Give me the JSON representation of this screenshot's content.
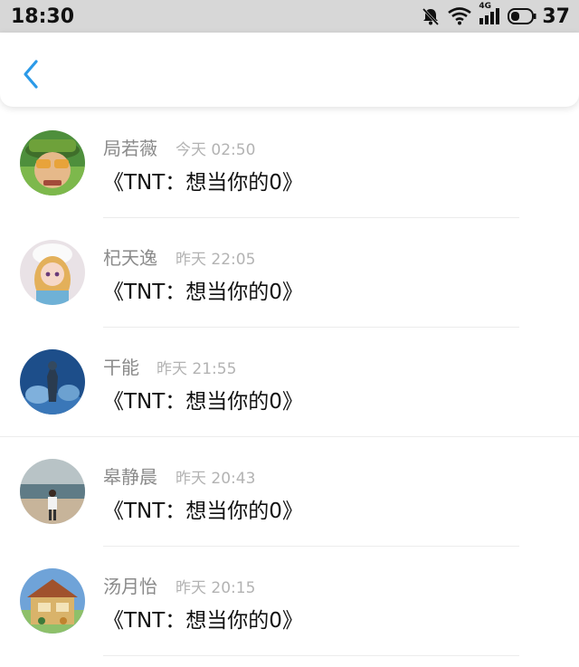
{
  "status_bar": {
    "time": "18:30",
    "network_label": "4G",
    "battery": "37",
    "icons": [
      "muted-bell-icon",
      "wifi-icon",
      "signal-icon",
      "battery-icon"
    ]
  },
  "header": {
    "back_icon": "chevron-left-icon",
    "accent_color": "#2b9ae8"
  },
  "messages": [
    {
      "name": "局若薇",
      "time": "今天 02:50",
      "message": "《TNT：想当你的0》"
    },
    {
      "name": "杞天逸",
      "time": "昨天 22:05",
      "message": "《TNT：想当你的0》"
    },
    {
      "name": "干能",
      "time": "昨天 21:55",
      "message": "《TNT：想当你的0》"
    },
    {
      "name": "皋静晨",
      "time": "昨天 20:43",
      "message": "《TNT：想当你的0》"
    },
    {
      "name": "汤月怡",
      "time": "昨天 20:15",
      "message": "《TNT：想当你的0》"
    }
  ]
}
